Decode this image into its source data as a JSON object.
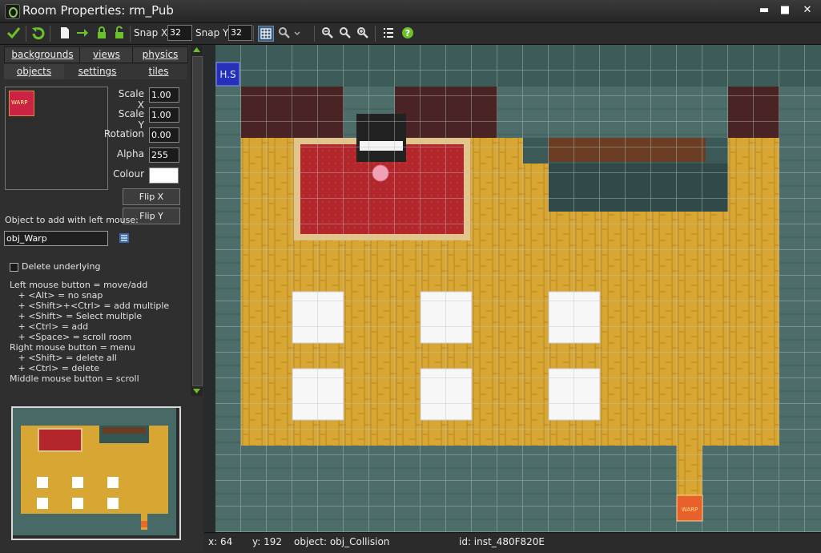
{
  "window": {
    "title": "Room Properties: rm_Pub",
    "minimize": "▬",
    "maximize": "■",
    "close": "✕"
  },
  "toolbar": {
    "snap_x_label": "Snap X:",
    "snap_x_value": "32",
    "snap_y_label": "Snap Y:",
    "snap_y_value": "32"
  },
  "tabs": {
    "row1": [
      "backgrounds",
      "views",
      "physics"
    ],
    "row2": [
      "objects",
      "settings",
      "tiles"
    ]
  },
  "object_panel": {
    "scale_x_label": "Scale X",
    "scale_x": "1.00",
    "scale_y_label": "Scale Y",
    "scale_y": "1.00",
    "rotation_label": "Rotation",
    "rotation": "0.00",
    "alpha_label": "Alpha",
    "alpha": "255",
    "colour_label": "Colour",
    "colour_value": "#ffffff",
    "flip_x": "Flip X",
    "flip_y": "Flip Y",
    "object_label": "Object to add with left mouse:",
    "object_value": "obj_Warp",
    "delete_underlying": "Delete underlying"
  },
  "help_lines": [
    "Left mouse button = move/add",
    "   + <Alt> = no snap",
    "   + <Shift>+<Ctrl> = add multiple",
    "   + <Shift> = Select multiple",
    "   + <Ctrl> = add",
    "   + <Space> = scroll room",
    "Right mouse button = menu",
    "   + <Shift> = delete all",
    "   + <Ctrl> = delete",
    "Middle mouse button = scroll"
  ],
  "room": {
    "hs_label": "H.S",
    "warp_label": "WARP"
  },
  "status": {
    "x": "x: 64",
    "y": "y: 192",
    "object": "object: obj_Collision",
    "id": "id: inst_480F820E"
  },
  "colors": {
    "wood": "#d8a733",
    "wall": "#4a6a66",
    "carpet": "#b3262b",
    "grid": "#b8c2c2",
    "accent_green": "#6cc02a"
  }
}
